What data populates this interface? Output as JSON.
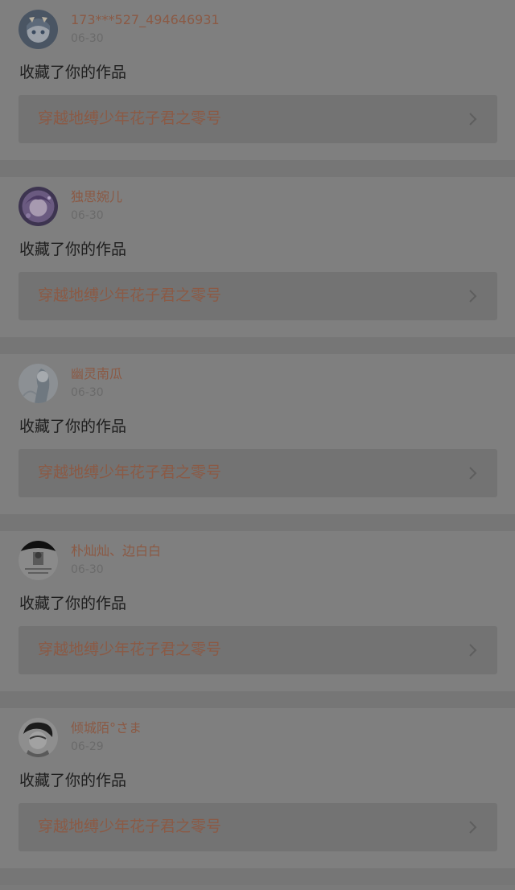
{
  "notifications": [
    {
      "username": "173***527_494646931",
      "date": "06-30",
      "action": "收藏了你的作品",
      "work_title": "穿越地缚少年花子君之零号",
      "avatar_icon": "anime-girl-avatar-icon"
    },
    {
      "username": "独思婉儿",
      "date": "06-30",
      "action": "收藏了你的作品",
      "work_title": "穿越地缚少年花子君之零号",
      "avatar_icon": "purple-anime-avatar-icon"
    },
    {
      "username": "幽灵南瓜",
      "date": "06-30",
      "action": "收藏了你的作品",
      "work_title": "穿越地缚少年花子君之零号",
      "avatar_icon": "pale-figure-avatar-icon"
    },
    {
      "username": "朴灿灿、边白白",
      "date": "06-30",
      "action": "收藏了你的作品",
      "work_title": "穿越地缚少年花子君之零号",
      "avatar_icon": "text-poster-avatar-icon"
    },
    {
      "username": "倾城陌°さま",
      "date": "06-29",
      "action": "收藏了你的作品",
      "work_title": "穿越地缚少年花子君之零号",
      "avatar_icon": "sketch-portrait-avatar-icon"
    }
  ],
  "colors": {
    "overlay_background": "#7a7a7a",
    "card_background": "#7f7f7f",
    "link_box_background": "#737373",
    "accent_text": "#8b5a45",
    "muted_text": "#6a6a6a",
    "body_text": "#1e1e1e"
  }
}
